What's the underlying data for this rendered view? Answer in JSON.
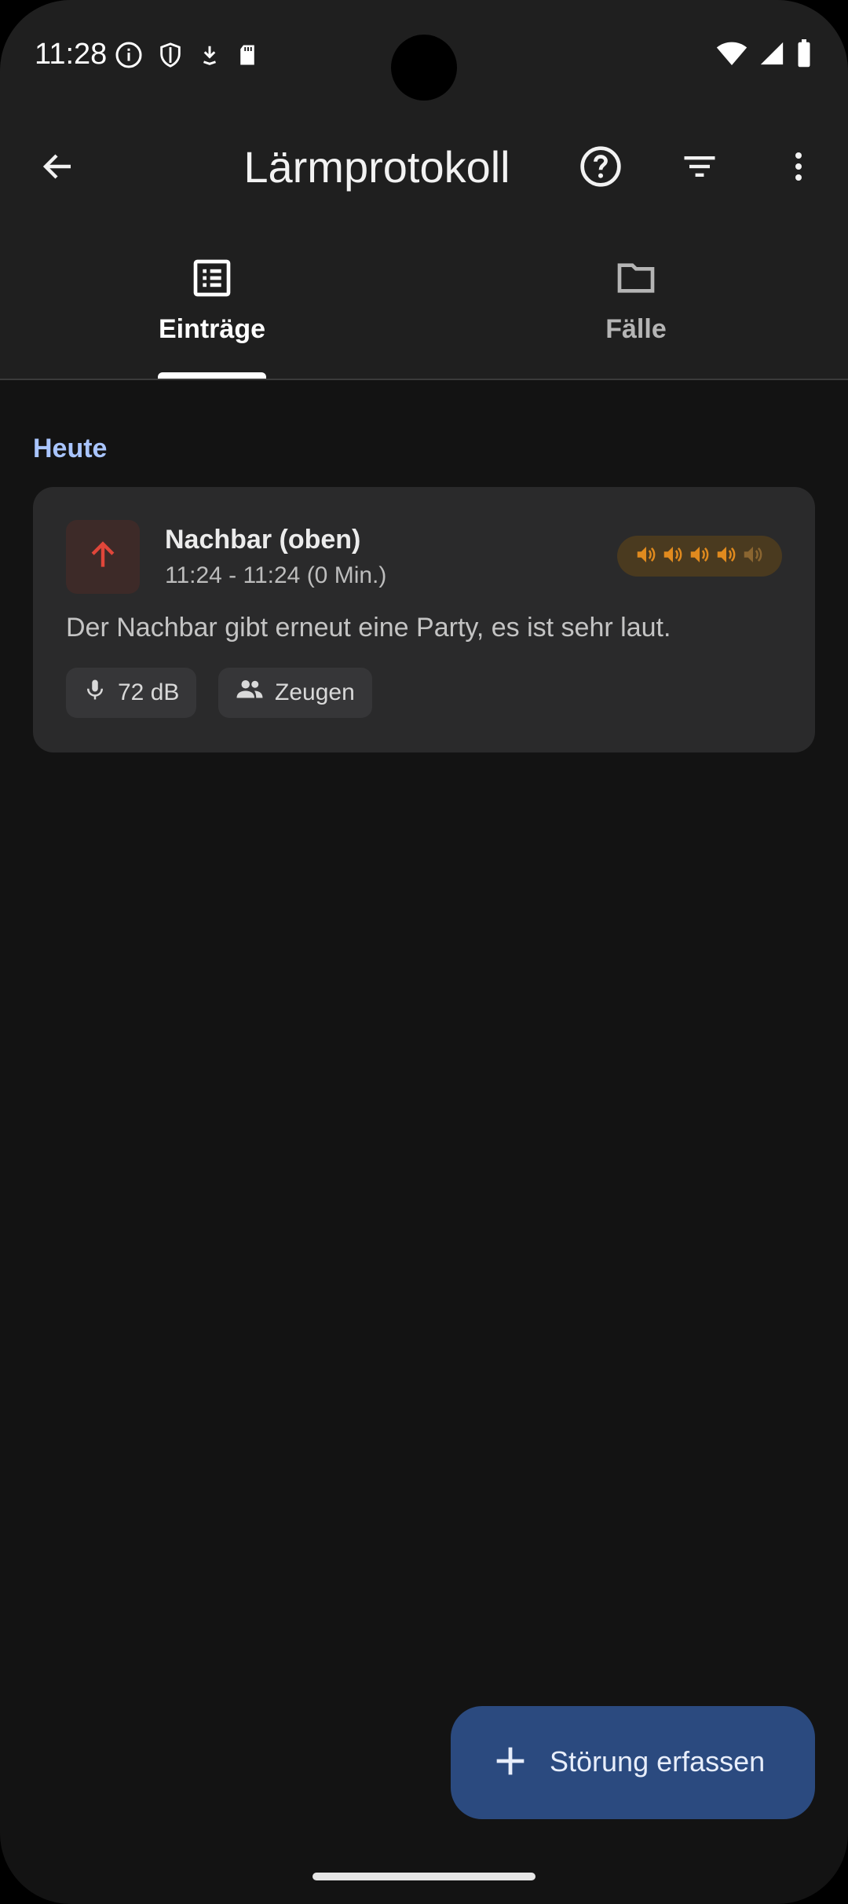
{
  "status_bar": {
    "time": "11:28",
    "left_icons": [
      "info-icon",
      "shield-icon",
      "download-icon",
      "sd-card-icon"
    ],
    "right_icons": [
      "wifi-icon",
      "signal-icon",
      "battery-icon"
    ]
  },
  "app_bar": {
    "title": "Lärmprotokoll",
    "actions": [
      "help-icon",
      "filter-icon",
      "more-vert-icon"
    ]
  },
  "tabs": [
    {
      "label": "Einträge",
      "icon": "list-icon",
      "selected": true
    },
    {
      "label": "Fälle",
      "icon": "folder-icon",
      "selected": false
    }
  ],
  "section": {
    "heading": "Heute"
  },
  "entry": {
    "title": "Nachbar (oben)",
    "time_range": "11:24 - 11:24 (0 Min.)",
    "description": "Der Nachbar gibt erneut eine Party, es ist sehr laut.",
    "loudness_level": 4,
    "loudness_max": 5,
    "chips": [
      {
        "icon": "mic-icon",
        "label": "72 dB"
      },
      {
        "icon": "people-icon",
        "label": "Zeugen"
      }
    ]
  },
  "fab": {
    "label": "Störung erfassen",
    "icon": "plus-icon"
  },
  "colors": {
    "background": "#131313",
    "surface": "#1f1f1f",
    "card": "#2a2a2b",
    "accent_heading": "#a9c5ff",
    "arrow_red": "#e0463a",
    "loudness_orange": "#e08a1e",
    "fab": "#2b4a7f"
  }
}
